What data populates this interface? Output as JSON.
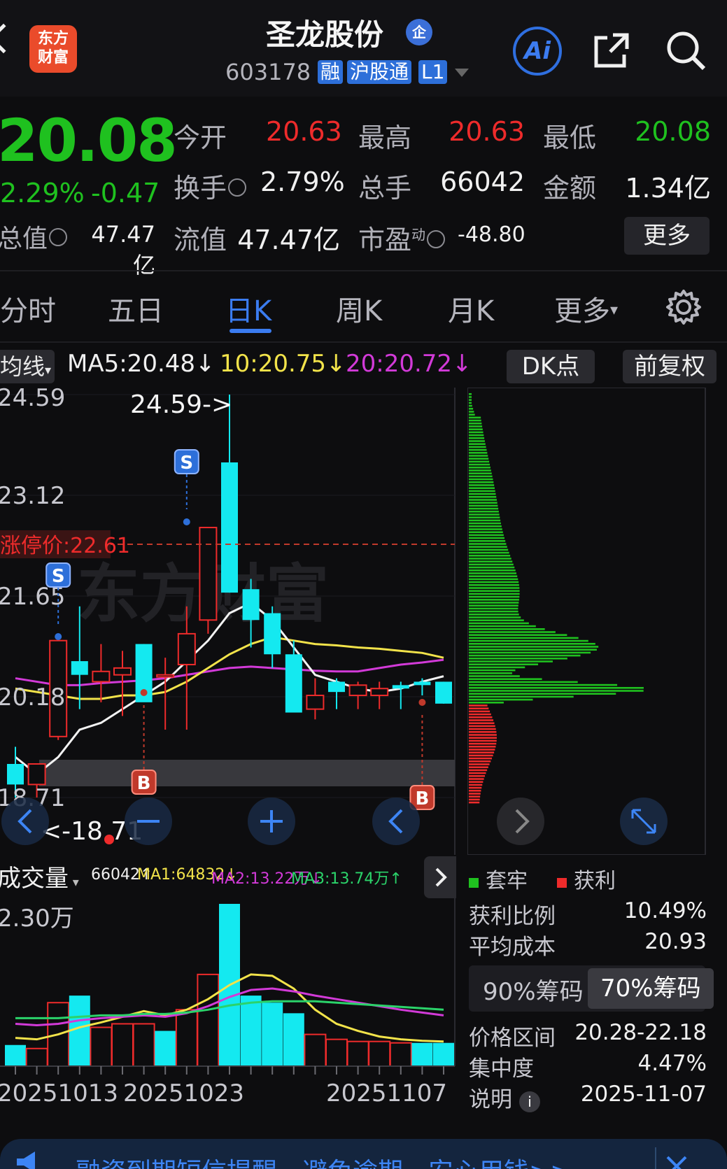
{
  "header": {
    "logo_text_line1": "东方",
    "logo_text_line2": "财富",
    "stock_name": "圣龙股份",
    "qi_badge": "企",
    "stock_code": "603178",
    "tags": [
      "融",
      "沪股通",
      "L1"
    ],
    "ai_label": "Ai"
  },
  "quote": {
    "price": "20.08",
    "change_pct": "2.29%",
    "change_abs": "-0.47",
    "open_label": "今开",
    "open": "20.63",
    "high_label": "最高",
    "high": "20.63",
    "low_label": "最低",
    "low": "20.08",
    "turnover_label": "换手",
    "turnover": "2.79%",
    "volume_label": "总手",
    "volume": "66042",
    "amount_label": "金额",
    "amount": "1.34亿",
    "mktcap_label": "总值",
    "mktcap": "47.47亿",
    "float_label": "流值",
    "float_cap": "47.47亿",
    "pe_label": "市盈",
    "pe_sup": "动",
    "pe": "-48.80",
    "more_button": "更多"
  },
  "tabs": [
    "分时",
    "五日",
    "日K",
    "周K",
    "月K",
    "更多"
  ],
  "active_tab": "日K",
  "ma_row": {
    "type_label": "均线",
    "ma5": "MA5:20.48",
    "ma10": "10:20.75",
    "ma20": "20:20.72",
    "dk_button": "DK点",
    "fq_button": "前复权"
  },
  "kline": {
    "y_labels": [
      "24.59",
      "23.12",
      "21.65",
      "20.18",
      "18.71"
    ],
    "high_marker": "24.59->",
    "low_marker": "<-18.71",
    "limit_price_label": "涨停价:22.61",
    "watermark": "东方财富",
    "signals": [
      {
        "label": "S"
      },
      {
        "label": "S"
      },
      {
        "label": "B"
      },
      {
        "label": "B"
      }
    ],
    "colors": {
      "up": "#ee2b2b",
      "down": "#14e9f0",
      "ma5": "#f2f2f2",
      "ma10": "#f2e34a",
      "ma20": "#d23ad8"
    }
  },
  "chart_data": {
    "type": "candlestick",
    "title": "",
    "ylim": [
      18.71,
      24.59
    ],
    "candles": [
      {
        "o": 19.2,
        "h": 19.45,
        "l": 18.71,
        "c": 18.9
      },
      {
        "o": 18.9,
        "h": 19.05,
        "l": 18.71,
        "c": 19.2
      },
      {
        "o": 19.6,
        "h": 21.0,
        "l": 19.55,
        "c": 21.0
      },
      {
        "o": 20.7,
        "h": 21.5,
        "l": 20.0,
        "c": 20.5
      },
      {
        "o": 20.4,
        "h": 20.95,
        "l": 20.1,
        "c": 20.55
      },
      {
        "o": 20.5,
        "h": 20.85,
        "l": 19.9,
        "c": 20.6
      },
      {
        "o": 20.95,
        "h": 20.95,
        "l": 20.2,
        "c": 20.1
      },
      {
        "o": 20.5,
        "h": 20.75,
        "l": 19.7,
        "c": 20.5
      },
      {
        "o": 20.65,
        "h": 21.5,
        "l": 19.7,
        "c": 21.1
      },
      {
        "o": 21.3,
        "h": 22.65,
        "l": 21.1,
        "c": 22.65
      },
      {
        "o": 23.6,
        "h": 24.59,
        "l": 21.7,
        "c": 21.7
      },
      {
        "o": 21.75,
        "h": 21.9,
        "l": 20.9,
        "c": 21.3
      },
      {
        "o": 21.4,
        "h": 21.5,
        "l": 20.6,
        "c": 20.8
      },
      {
        "o": 20.8,
        "h": 21.0,
        "l": 19.95,
        "c": 19.95
      },
      {
        "o": 20.0,
        "h": 20.45,
        "l": 19.85,
        "c": 20.2
      },
      {
        "o": 20.4,
        "h": 20.45,
        "l": 20.0,
        "c": 20.25
      },
      {
        "o": 20.2,
        "h": 20.4,
        "l": 20.0,
        "c": 20.35
      },
      {
        "o": 20.2,
        "h": 20.4,
        "l": 20.0,
        "c": 20.3
      },
      {
        "o": 20.35,
        "h": 20.4,
        "l": 20.0,
        "c": 20.3
      },
      {
        "o": 20.4,
        "h": 20.45,
        "l": 20.2,
        "c": 20.35
      },
      {
        "o": 20.4,
        "h": 20.4,
        "l": 20.08,
        "c": 20.08
      }
    ],
    "ma5_series": [
      19.3,
      19.05,
      19.3,
      19.7,
      19.8,
      20.0,
      20.2,
      20.4,
      20.7,
      21.0,
      21.4,
      21.55,
      21.3,
      20.9,
      20.5,
      20.4,
      20.3,
      20.25,
      20.3,
      20.4,
      20.48
    ],
    "ma10_series": [
      20.3,
      20.25,
      20.2,
      20.15,
      20.15,
      20.2,
      20.2,
      20.25,
      20.4,
      20.6,
      20.8,
      20.95,
      21.05,
      21.0,
      20.95,
      20.93,
      20.9,
      20.88,
      20.85,
      20.82,
      20.75
    ],
    "ma20_series": [
      20.45,
      20.4,
      20.35,
      20.35,
      20.38,
      20.4,
      20.42,
      20.45,
      20.5,
      20.55,
      20.6,
      20.62,
      20.6,
      20.58,
      20.56,
      20.55,
      20.55,
      20.6,
      20.65,
      20.68,
      20.72
    ],
    "volume": {
      "max_label": "2.30万",
      "values": [
        0.3,
        0.25,
        0.9,
        1.0,
        0.55,
        0.6,
        0.6,
        0.5,
        0.8,
        1.3,
        2.3,
        1.0,
        0.9,
        0.75,
        0.45,
        0.38,
        0.35,
        0.35,
        0.33,
        0.33,
        0.33
      ],
      "up_flags": [
        false,
        true,
        true,
        false,
        true,
        true,
        true,
        false,
        true,
        true,
        false,
        false,
        false,
        false,
        true,
        true,
        true,
        true,
        true,
        false,
        false
      ]
    },
    "dates": [
      "20251013",
      "20251023",
      "20251107"
    ]
  },
  "volume_panel": {
    "type_label": "成交量",
    "vol": "66042",
    "ma1": "MA1:64832",
    "ma2": "MA2:13.22万",
    "ma3": "MA3:13.74万"
  },
  "chip_panel": {
    "legend_locked": "套牢",
    "legend_profit": "获利",
    "profit_ratio_label": "获利比例",
    "profit_ratio": "10.49%",
    "avg_cost_label": "平均成本",
    "avg_cost": "20.93",
    "opt_90": "90%筹码",
    "opt_70": "70%筹码",
    "range_label": "价格区间",
    "range": "20.28-22.18",
    "concentration_label": "集中度",
    "concentration": "4.47%",
    "note_label": "说明",
    "note_date": "2025-11-07",
    "colors": {
      "locked": "#1fc11f",
      "profit": "#ee2b2b"
    }
  },
  "banner": {
    "text": "融资到期短信提醒，避免逾期，安心用钱>>"
  }
}
